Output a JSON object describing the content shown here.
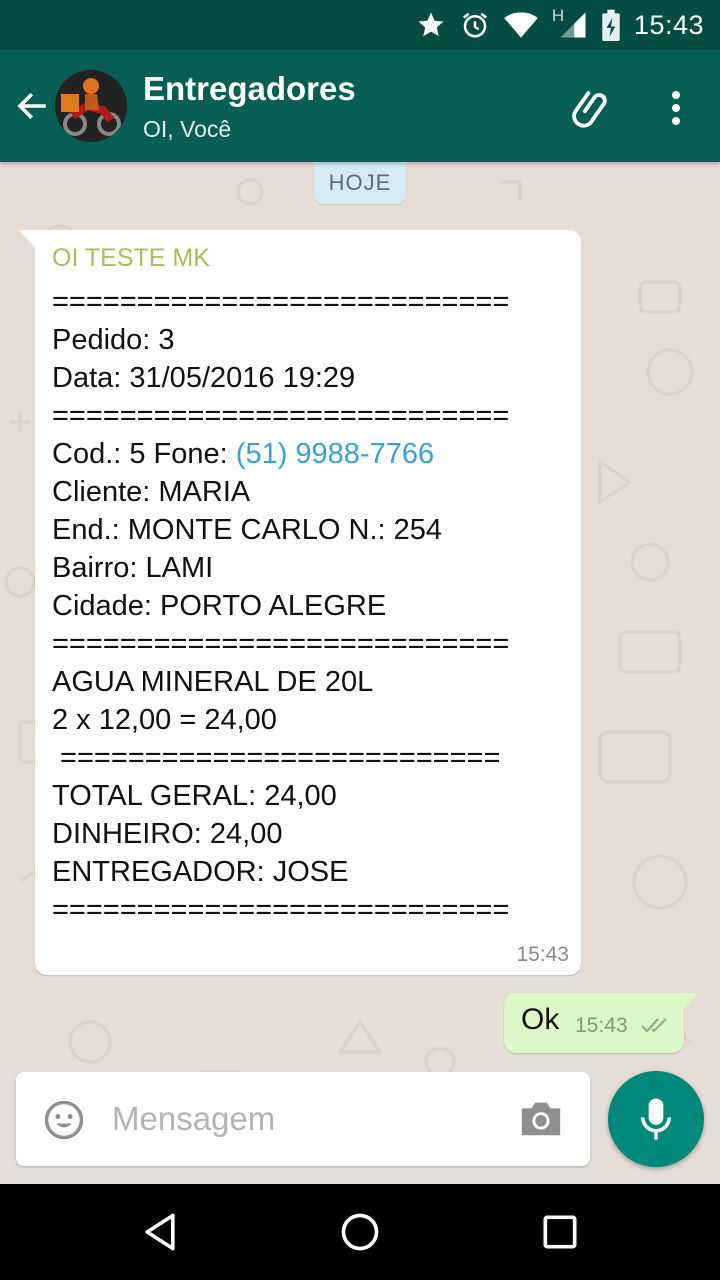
{
  "status_bar": {
    "time": "15:43",
    "network_label": "H",
    "icons": [
      "star-icon",
      "alarm-icon",
      "wifi-icon",
      "signal-icon",
      "battery-charging-icon"
    ]
  },
  "header": {
    "title": "Entregadores",
    "subtitle": "OI, Você",
    "colors": {
      "bar": "#075e54",
      "status": "#054d44"
    }
  },
  "chat": {
    "date_chip": "HOJE",
    "incoming": {
      "sender": "OI TESTE MK",
      "sender_color": "#a5c154",
      "lines": [
        "===========================",
        "Pedido: 3",
        "Data: 31/05/2016 19:29",
        "===========================",
        "Cod.: 5 Fone: ",
        "Cliente: MARIA",
        "End.: MONTE CARLO N.: 254",
        "Bairro: LAMI",
        "Cidade: PORTO ALEGRE",
        "===========================",
        "AGUA MINERAL DE 20L",
        "2 x 12,00 = 24,00",
        " ==========================",
        "TOTAL GERAL: 24,00",
        "DINHEIRO: 24,00",
        "ENTREGADOR: JOSE",
        "==========================="
      ],
      "phone": "(51) 9988-7766",
      "time": "15:43"
    },
    "outgoing": {
      "text": "Ok",
      "time": "15:43",
      "status_icon": "double-check-icon"
    }
  },
  "composer": {
    "placeholder": "Mensagem",
    "value": ""
  }
}
